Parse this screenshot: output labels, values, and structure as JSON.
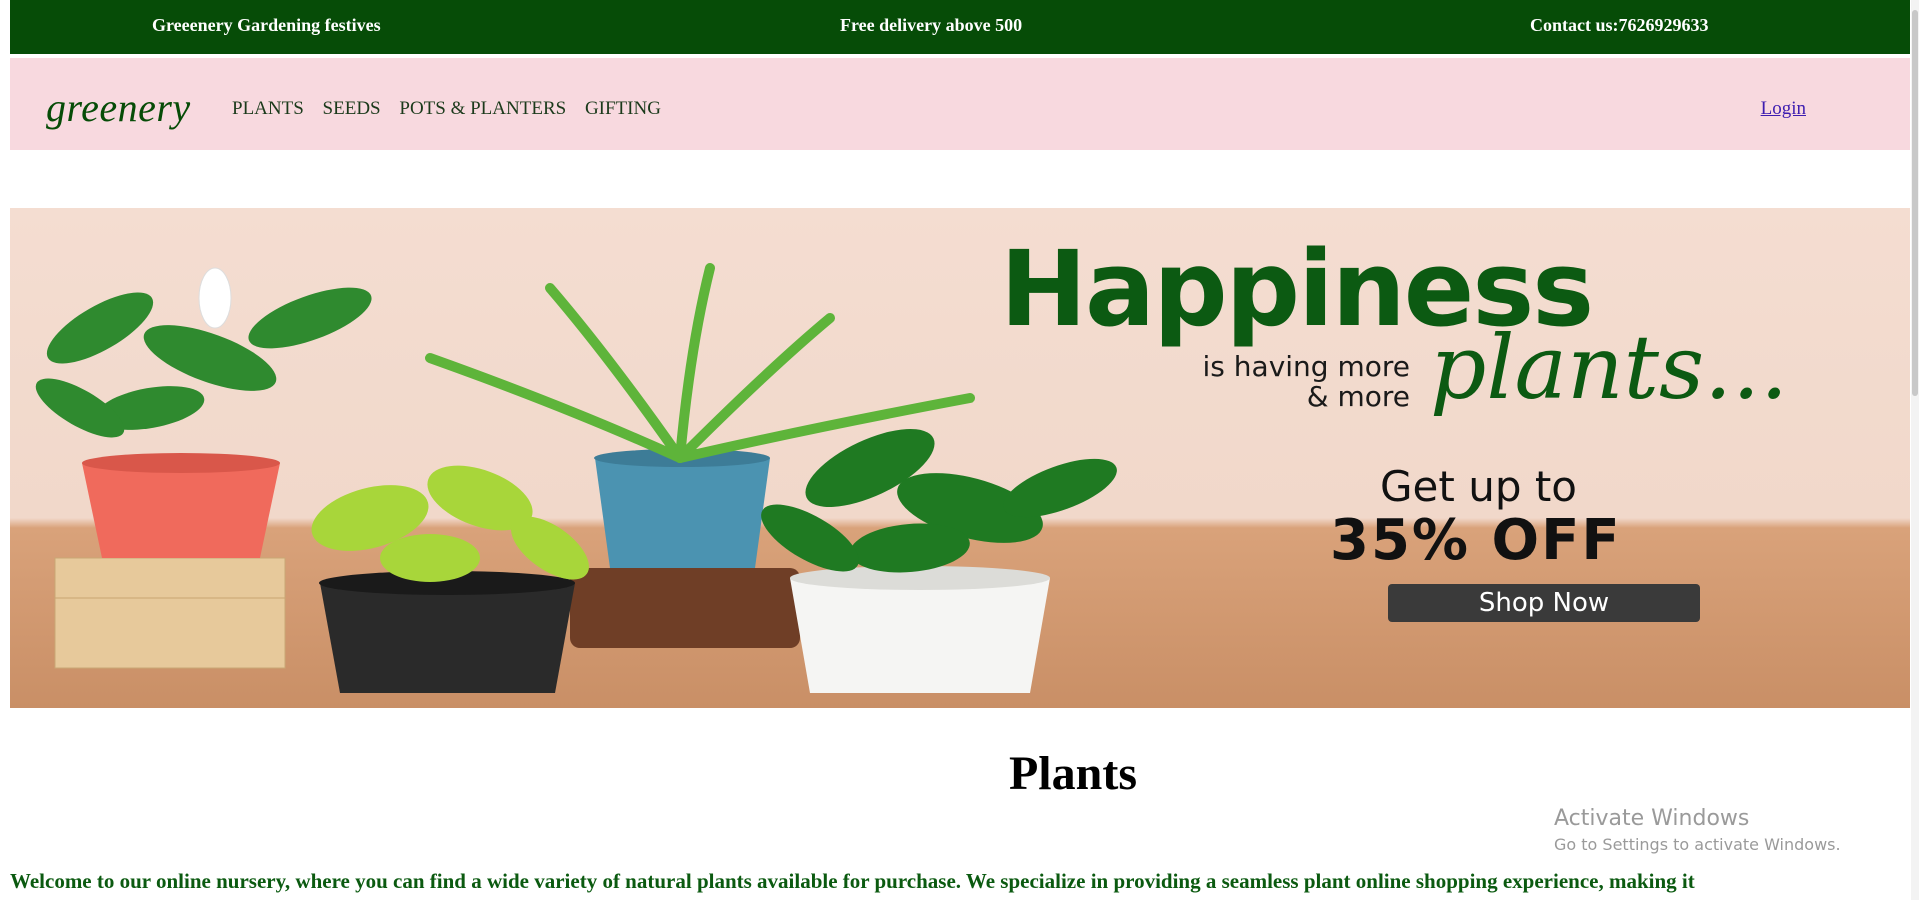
{
  "topbar": {
    "left": "Greeenery Gardening festives",
    "center": "Free delivery above 500",
    "right": "Contact us:7626929633"
  },
  "nav": {
    "logo": "greenery",
    "links": [
      "PLANTS",
      "SEEDS",
      "POTS & PLANTERS",
      "GIFTING"
    ],
    "login": "Login"
  },
  "hero": {
    "headline": "Happiness",
    "tagline": [
      "is having more",
      "& more"
    ],
    "script_word": "plants...",
    "offer_line1": "Get up to",
    "offer_line2": "35% OFF",
    "cta": "Shop Now"
  },
  "section": {
    "title": "Plants",
    "intro": "Welcome to our online nursery, where you can find a wide variety of natural plants available for purchase. We specialize in providing a seamless plant online shopping experience, making it"
  },
  "watermark": {
    "title": "Activate Windows",
    "subtitle": "Go to Settings to activate Windows."
  },
  "colors": {
    "brand_green": "#064c07",
    "nav_pink": "#f8d9df",
    "text_green": "#0b5a10"
  }
}
